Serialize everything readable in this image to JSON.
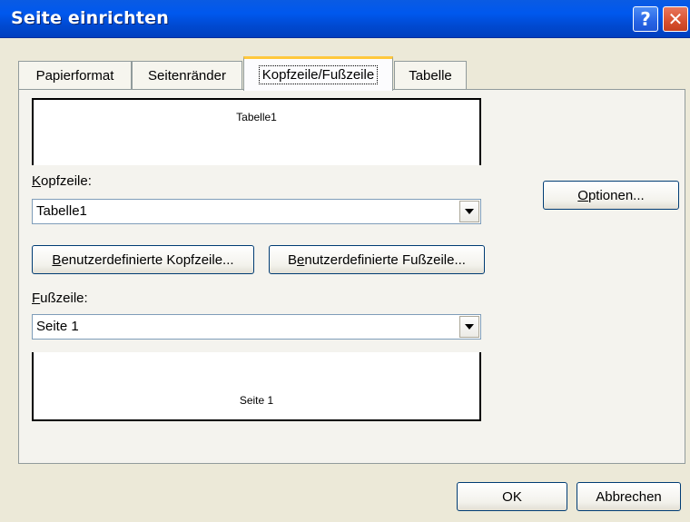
{
  "window": {
    "title": "Seite einrichten",
    "help_glyph": "?",
    "close_glyph": "✕"
  },
  "tabs": [
    {
      "label": "Papierformat"
    },
    {
      "label": "Seitenränder"
    },
    {
      "label": "Kopfzeile/Fußzeile",
      "active": true
    },
    {
      "label": "Tabelle"
    }
  ],
  "header": {
    "preview_text": "Tabelle1",
    "label_mnemonic": "K",
    "label_rest": "opfzeile:",
    "value": "Tabelle1"
  },
  "footer": {
    "preview_text": "Seite 1",
    "label_mnemonic": "F",
    "label_rest": "ußzeile:",
    "value": "Seite 1"
  },
  "buttons": {
    "custom_header_mnemonic": "B",
    "custom_header_rest": "enutzerdefinierte Kopfzeile...",
    "custom_footer_pre": "B",
    "custom_footer_mnemonic": "e",
    "custom_footer_rest": "nutzerdefinierte Fußzeile...",
    "options_mnemonic": "O",
    "options_rest": "ptionen...",
    "ok": "OK",
    "cancel": "Abbrechen"
  }
}
